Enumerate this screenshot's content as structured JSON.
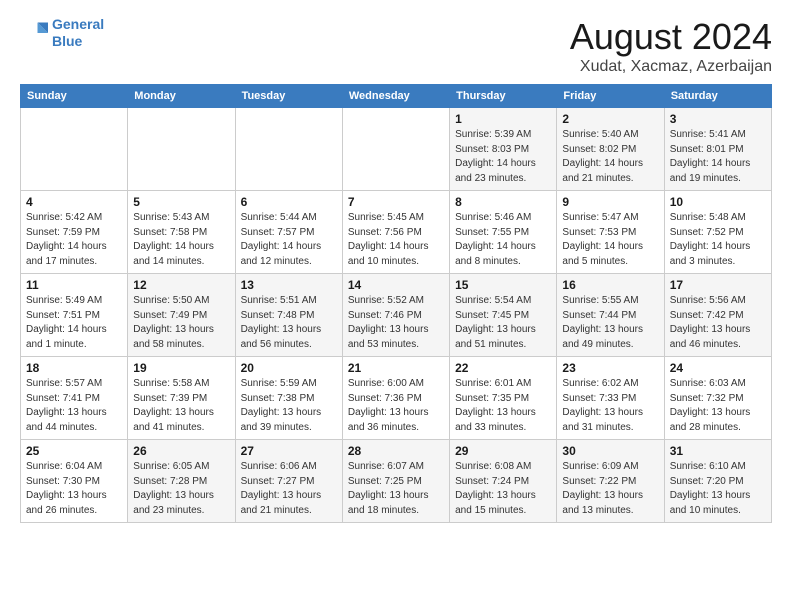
{
  "logo": {
    "line1": "General",
    "line2": "Blue"
  },
  "title": "August 2024",
  "subtitle": "Xudat, Xacmaz, Azerbaijan",
  "days_of_week": [
    "Sunday",
    "Monday",
    "Tuesday",
    "Wednesday",
    "Thursday",
    "Friday",
    "Saturday"
  ],
  "weeks": [
    [
      {
        "num": "",
        "info": ""
      },
      {
        "num": "",
        "info": ""
      },
      {
        "num": "",
        "info": ""
      },
      {
        "num": "",
        "info": ""
      },
      {
        "num": "1",
        "info": "Sunrise: 5:39 AM\nSunset: 8:03 PM\nDaylight: 14 hours\nand 23 minutes."
      },
      {
        "num": "2",
        "info": "Sunrise: 5:40 AM\nSunset: 8:02 PM\nDaylight: 14 hours\nand 21 minutes."
      },
      {
        "num": "3",
        "info": "Sunrise: 5:41 AM\nSunset: 8:01 PM\nDaylight: 14 hours\nand 19 minutes."
      }
    ],
    [
      {
        "num": "4",
        "info": "Sunrise: 5:42 AM\nSunset: 7:59 PM\nDaylight: 14 hours\nand 17 minutes."
      },
      {
        "num": "5",
        "info": "Sunrise: 5:43 AM\nSunset: 7:58 PM\nDaylight: 14 hours\nand 14 minutes."
      },
      {
        "num": "6",
        "info": "Sunrise: 5:44 AM\nSunset: 7:57 PM\nDaylight: 14 hours\nand 12 minutes."
      },
      {
        "num": "7",
        "info": "Sunrise: 5:45 AM\nSunset: 7:56 PM\nDaylight: 14 hours\nand 10 minutes."
      },
      {
        "num": "8",
        "info": "Sunrise: 5:46 AM\nSunset: 7:55 PM\nDaylight: 14 hours\nand 8 minutes."
      },
      {
        "num": "9",
        "info": "Sunrise: 5:47 AM\nSunset: 7:53 PM\nDaylight: 14 hours\nand 5 minutes."
      },
      {
        "num": "10",
        "info": "Sunrise: 5:48 AM\nSunset: 7:52 PM\nDaylight: 14 hours\nand 3 minutes."
      }
    ],
    [
      {
        "num": "11",
        "info": "Sunrise: 5:49 AM\nSunset: 7:51 PM\nDaylight: 14 hours\nand 1 minute."
      },
      {
        "num": "12",
        "info": "Sunrise: 5:50 AM\nSunset: 7:49 PM\nDaylight: 13 hours\nand 58 minutes."
      },
      {
        "num": "13",
        "info": "Sunrise: 5:51 AM\nSunset: 7:48 PM\nDaylight: 13 hours\nand 56 minutes."
      },
      {
        "num": "14",
        "info": "Sunrise: 5:52 AM\nSunset: 7:46 PM\nDaylight: 13 hours\nand 53 minutes."
      },
      {
        "num": "15",
        "info": "Sunrise: 5:54 AM\nSunset: 7:45 PM\nDaylight: 13 hours\nand 51 minutes."
      },
      {
        "num": "16",
        "info": "Sunrise: 5:55 AM\nSunset: 7:44 PM\nDaylight: 13 hours\nand 49 minutes."
      },
      {
        "num": "17",
        "info": "Sunrise: 5:56 AM\nSunset: 7:42 PM\nDaylight: 13 hours\nand 46 minutes."
      }
    ],
    [
      {
        "num": "18",
        "info": "Sunrise: 5:57 AM\nSunset: 7:41 PM\nDaylight: 13 hours\nand 44 minutes."
      },
      {
        "num": "19",
        "info": "Sunrise: 5:58 AM\nSunset: 7:39 PM\nDaylight: 13 hours\nand 41 minutes."
      },
      {
        "num": "20",
        "info": "Sunrise: 5:59 AM\nSunset: 7:38 PM\nDaylight: 13 hours\nand 39 minutes."
      },
      {
        "num": "21",
        "info": "Sunrise: 6:00 AM\nSunset: 7:36 PM\nDaylight: 13 hours\nand 36 minutes."
      },
      {
        "num": "22",
        "info": "Sunrise: 6:01 AM\nSunset: 7:35 PM\nDaylight: 13 hours\nand 33 minutes."
      },
      {
        "num": "23",
        "info": "Sunrise: 6:02 AM\nSunset: 7:33 PM\nDaylight: 13 hours\nand 31 minutes."
      },
      {
        "num": "24",
        "info": "Sunrise: 6:03 AM\nSunset: 7:32 PM\nDaylight: 13 hours\nand 28 minutes."
      }
    ],
    [
      {
        "num": "25",
        "info": "Sunrise: 6:04 AM\nSunset: 7:30 PM\nDaylight: 13 hours\nand 26 minutes."
      },
      {
        "num": "26",
        "info": "Sunrise: 6:05 AM\nSunset: 7:28 PM\nDaylight: 13 hours\nand 23 minutes."
      },
      {
        "num": "27",
        "info": "Sunrise: 6:06 AM\nSunset: 7:27 PM\nDaylight: 13 hours\nand 21 minutes."
      },
      {
        "num": "28",
        "info": "Sunrise: 6:07 AM\nSunset: 7:25 PM\nDaylight: 13 hours\nand 18 minutes."
      },
      {
        "num": "29",
        "info": "Sunrise: 6:08 AM\nSunset: 7:24 PM\nDaylight: 13 hours\nand 15 minutes."
      },
      {
        "num": "30",
        "info": "Sunrise: 6:09 AM\nSunset: 7:22 PM\nDaylight: 13 hours\nand 13 minutes."
      },
      {
        "num": "31",
        "info": "Sunrise: 6:10 AM\nSunset: 7:20 PM\nDaylight: 13 hours\nand 10 minutes."
      }
    ]
  ]
}
